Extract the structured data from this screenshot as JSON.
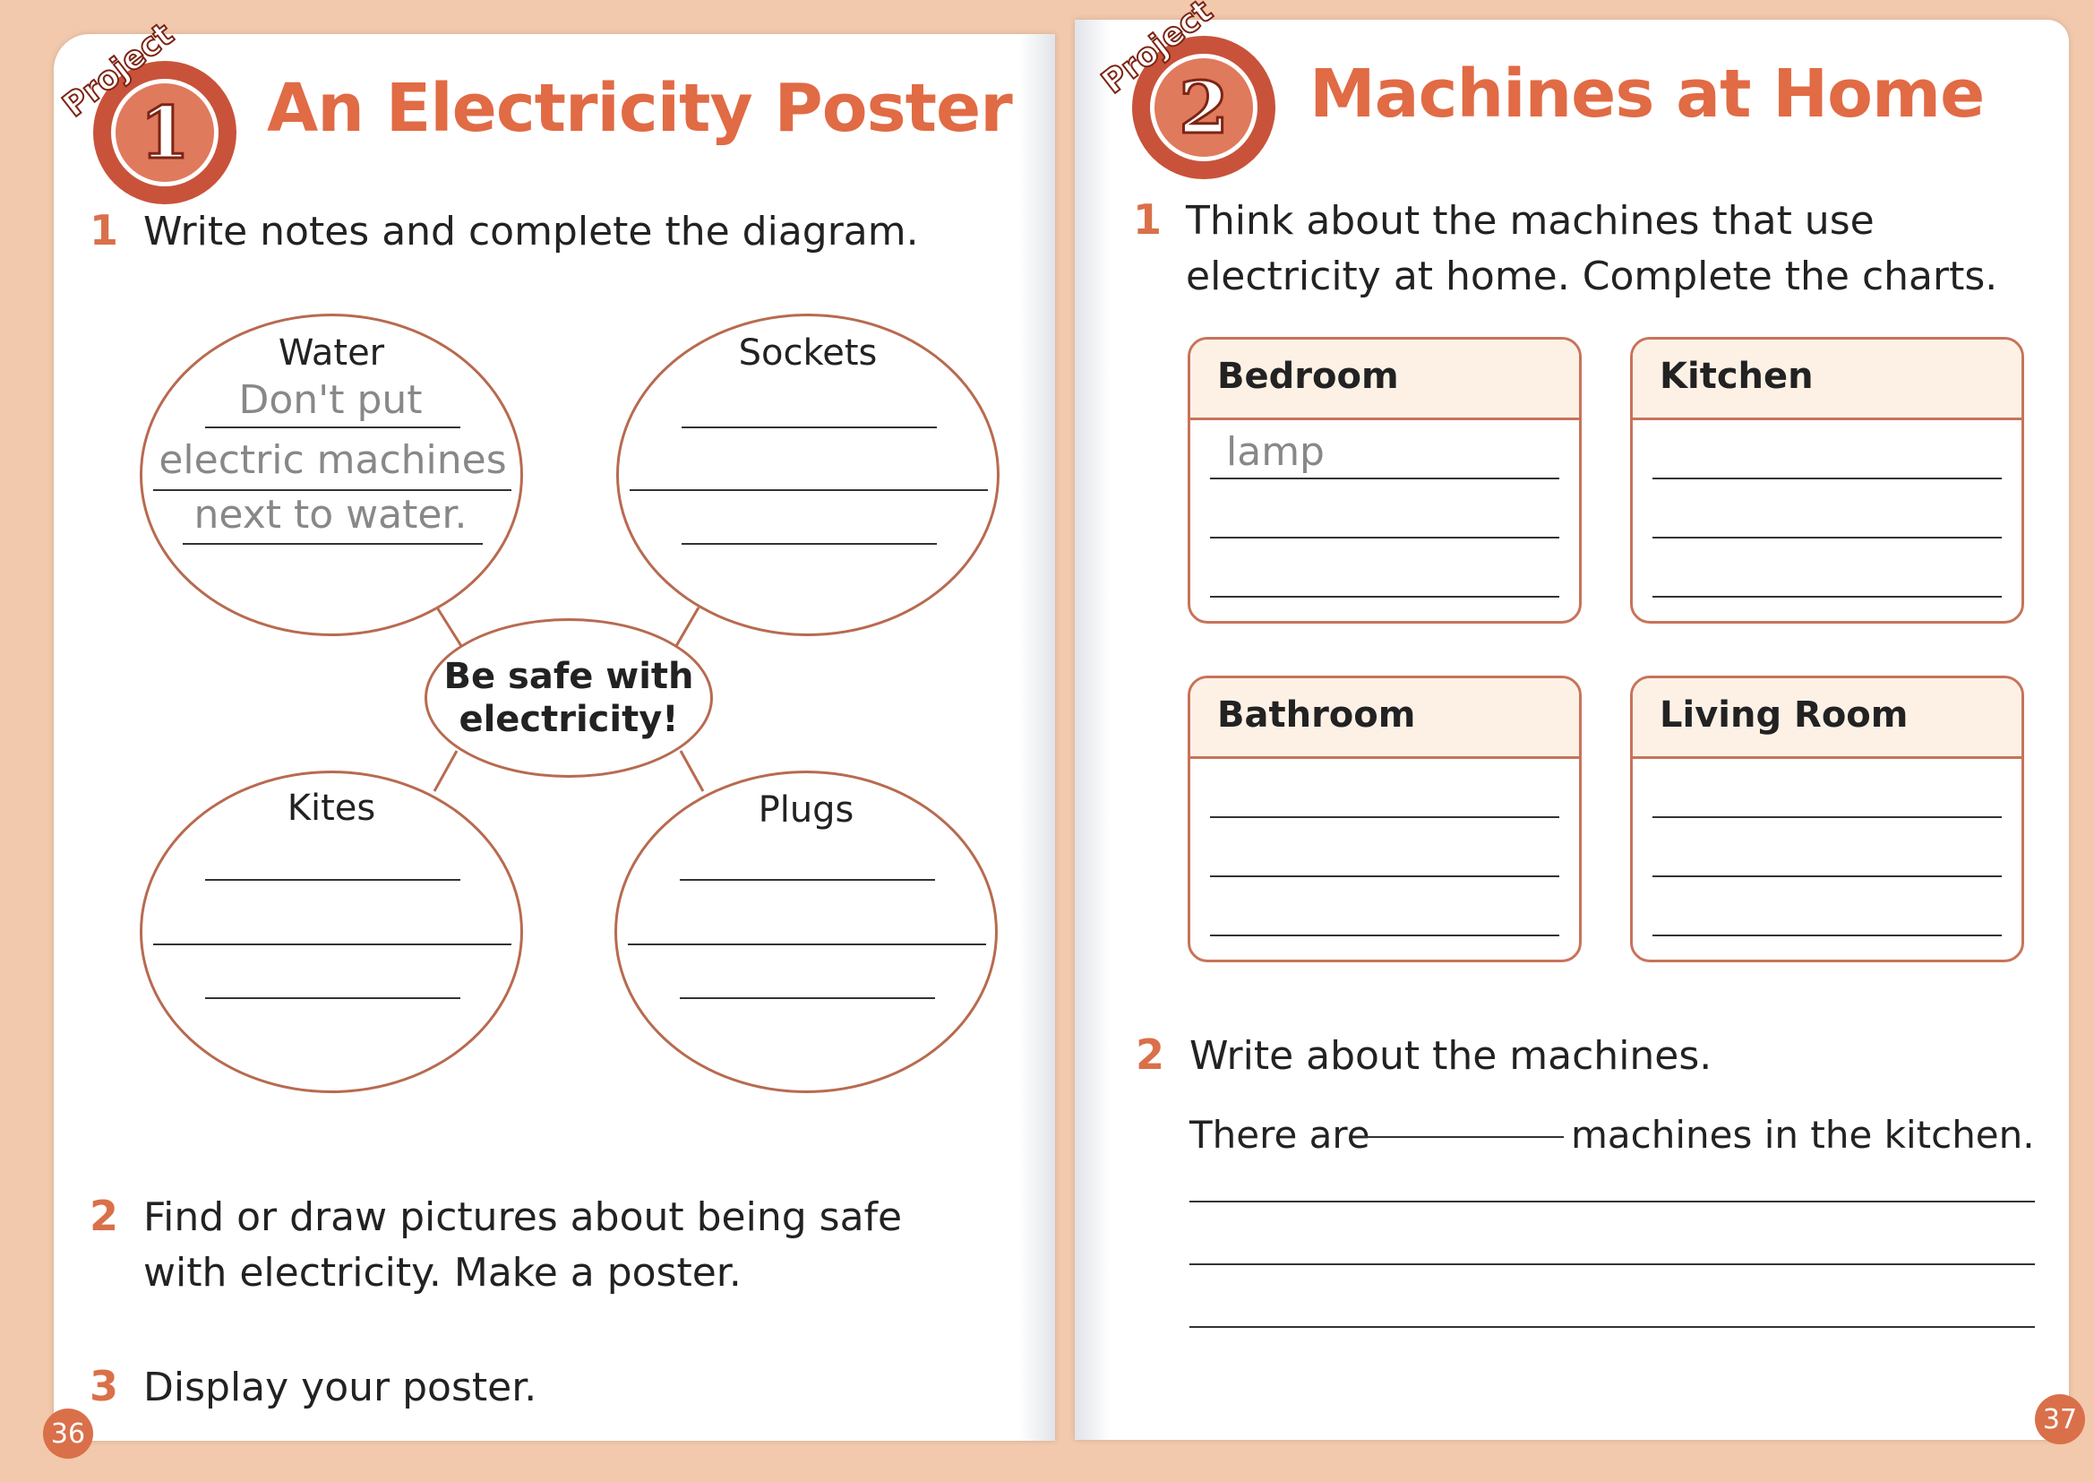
{
  "left_page": {
    "badge": {
      "label": "Project",
      "number": "1"
    },
    "title": "An Electricity Poster",
    "questions": [
      {
        "num": "1",
        "text": "Write notes and complete the diagram."
      },
      {
        "num": "2",
        "text": "Find or draw pictures about being safe with electricity. Make a poster."
      },
      {
        "num": "3",
        "text": "Display your poster."
      }
    ],
    "diagram": {
      "center": "Be safe with electricity!",
      "bubbles": [
        {
          "label": "Water",
          "handwriting": [
            "Don't put",
            "electric machines",
            "next to water."
          ]
        },
        {
          "label": "Sockets"
        },
        {
          "label": "Kites"
        },
        {
          "label": "Plugs"
        }
      ]
    },
    "page_number": "36"
  },
  "right_page": {
    "badge": {
      "label": "Project",
      "number": "2"
    },
    "title": "Machines at Home",
    "questions": [
      {
        "num": "1",
        "text": "Think about the machines that use electricity at home. Complete the charts."
      },
      {
        "num": "2",
        "text": "Write about the machines."
      }
    ],
    "charts": [
      {
        "title": "Bedroom",
        "handwriting": "lamp"
      },
      {
        "title": "Kitchen"
      },
      {
        "title": "Bathroom"
      },
      {
        "title": "Living Room"
      }
    ],
    "sentence": {
      "before": "There are",
      "after": "machines in the kitchen."
    },
    "page_number": "37"
  }
}
